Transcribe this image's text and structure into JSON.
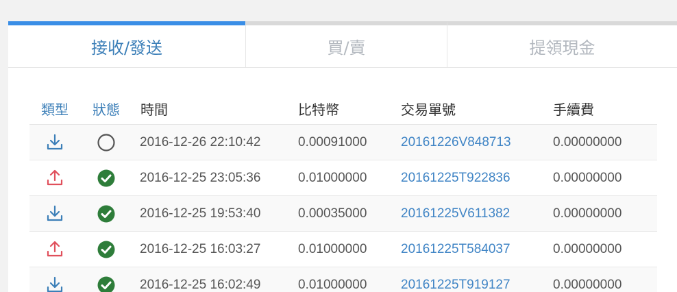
{
  "tabs": [
    {
      "label": "接收/發送",
      "active": true
    },
    {
      "label": "買/賣",
      "active": false
    },
    {
      "label": "提領現金",
      "active": false
    }
  ],
  "table": {
    "headers": [
      "類型",
      "狀態",
      "時間",
      "比特幣",
      "交易單號",
      "手續費"
    ],
    "rows": [
      {
        "type_icon": "download-icon",
        "status_icon": "pending-circle-icon",
        "time": "2016-12-26 22:10:42",
        "btc": "0.00091000",
        "txid": "20161226V848713",
        "fee": "0.00000000"
      },
      {
        "type_icon": "upload-icon",
        "status_icon": "check-circle-icon",
        "time": "2016-12-25 23:05:36",
        "btc": "0.01000000",
        "txid": "20161225T922836",
        "fee": "0.00000000"
      },
      {
        "type_icon": "download-icon",
        "status_icon": "check-circle-icon",
        "time": "2016-12-25 19:53:40",
        "btc": "0.00035000",
        "txid": "20161225V611382",
        "fee": "0.00000000"
      },
      {
        "type_icon": "upload-icon",
        "status_icon": "check-circle-icon",
        "time": "2016-12-25 16:03:27",
        "btc": "0.01000000",
        "txid": "20161225T584037",
        "fee": "0.00000000"
      },
      {
        "type_icon": "download-icon",
        "status_icon": "check-circle-icon",
        "time": "2016-12-25 16:02:49",
        "btc": "0.01000000",
        "txid": "20161225T919127",
        "fee": "0.00000000"
      }
    ]
  },
  "colors": {
    "accent": "#3a8ee6",
    "download": "#3c7fb8",
    "upload": "#e0505c",
    "success": "#2e7d3a",
    "pending": "#555555",
    "link": "#3f84c5"
  }
}
